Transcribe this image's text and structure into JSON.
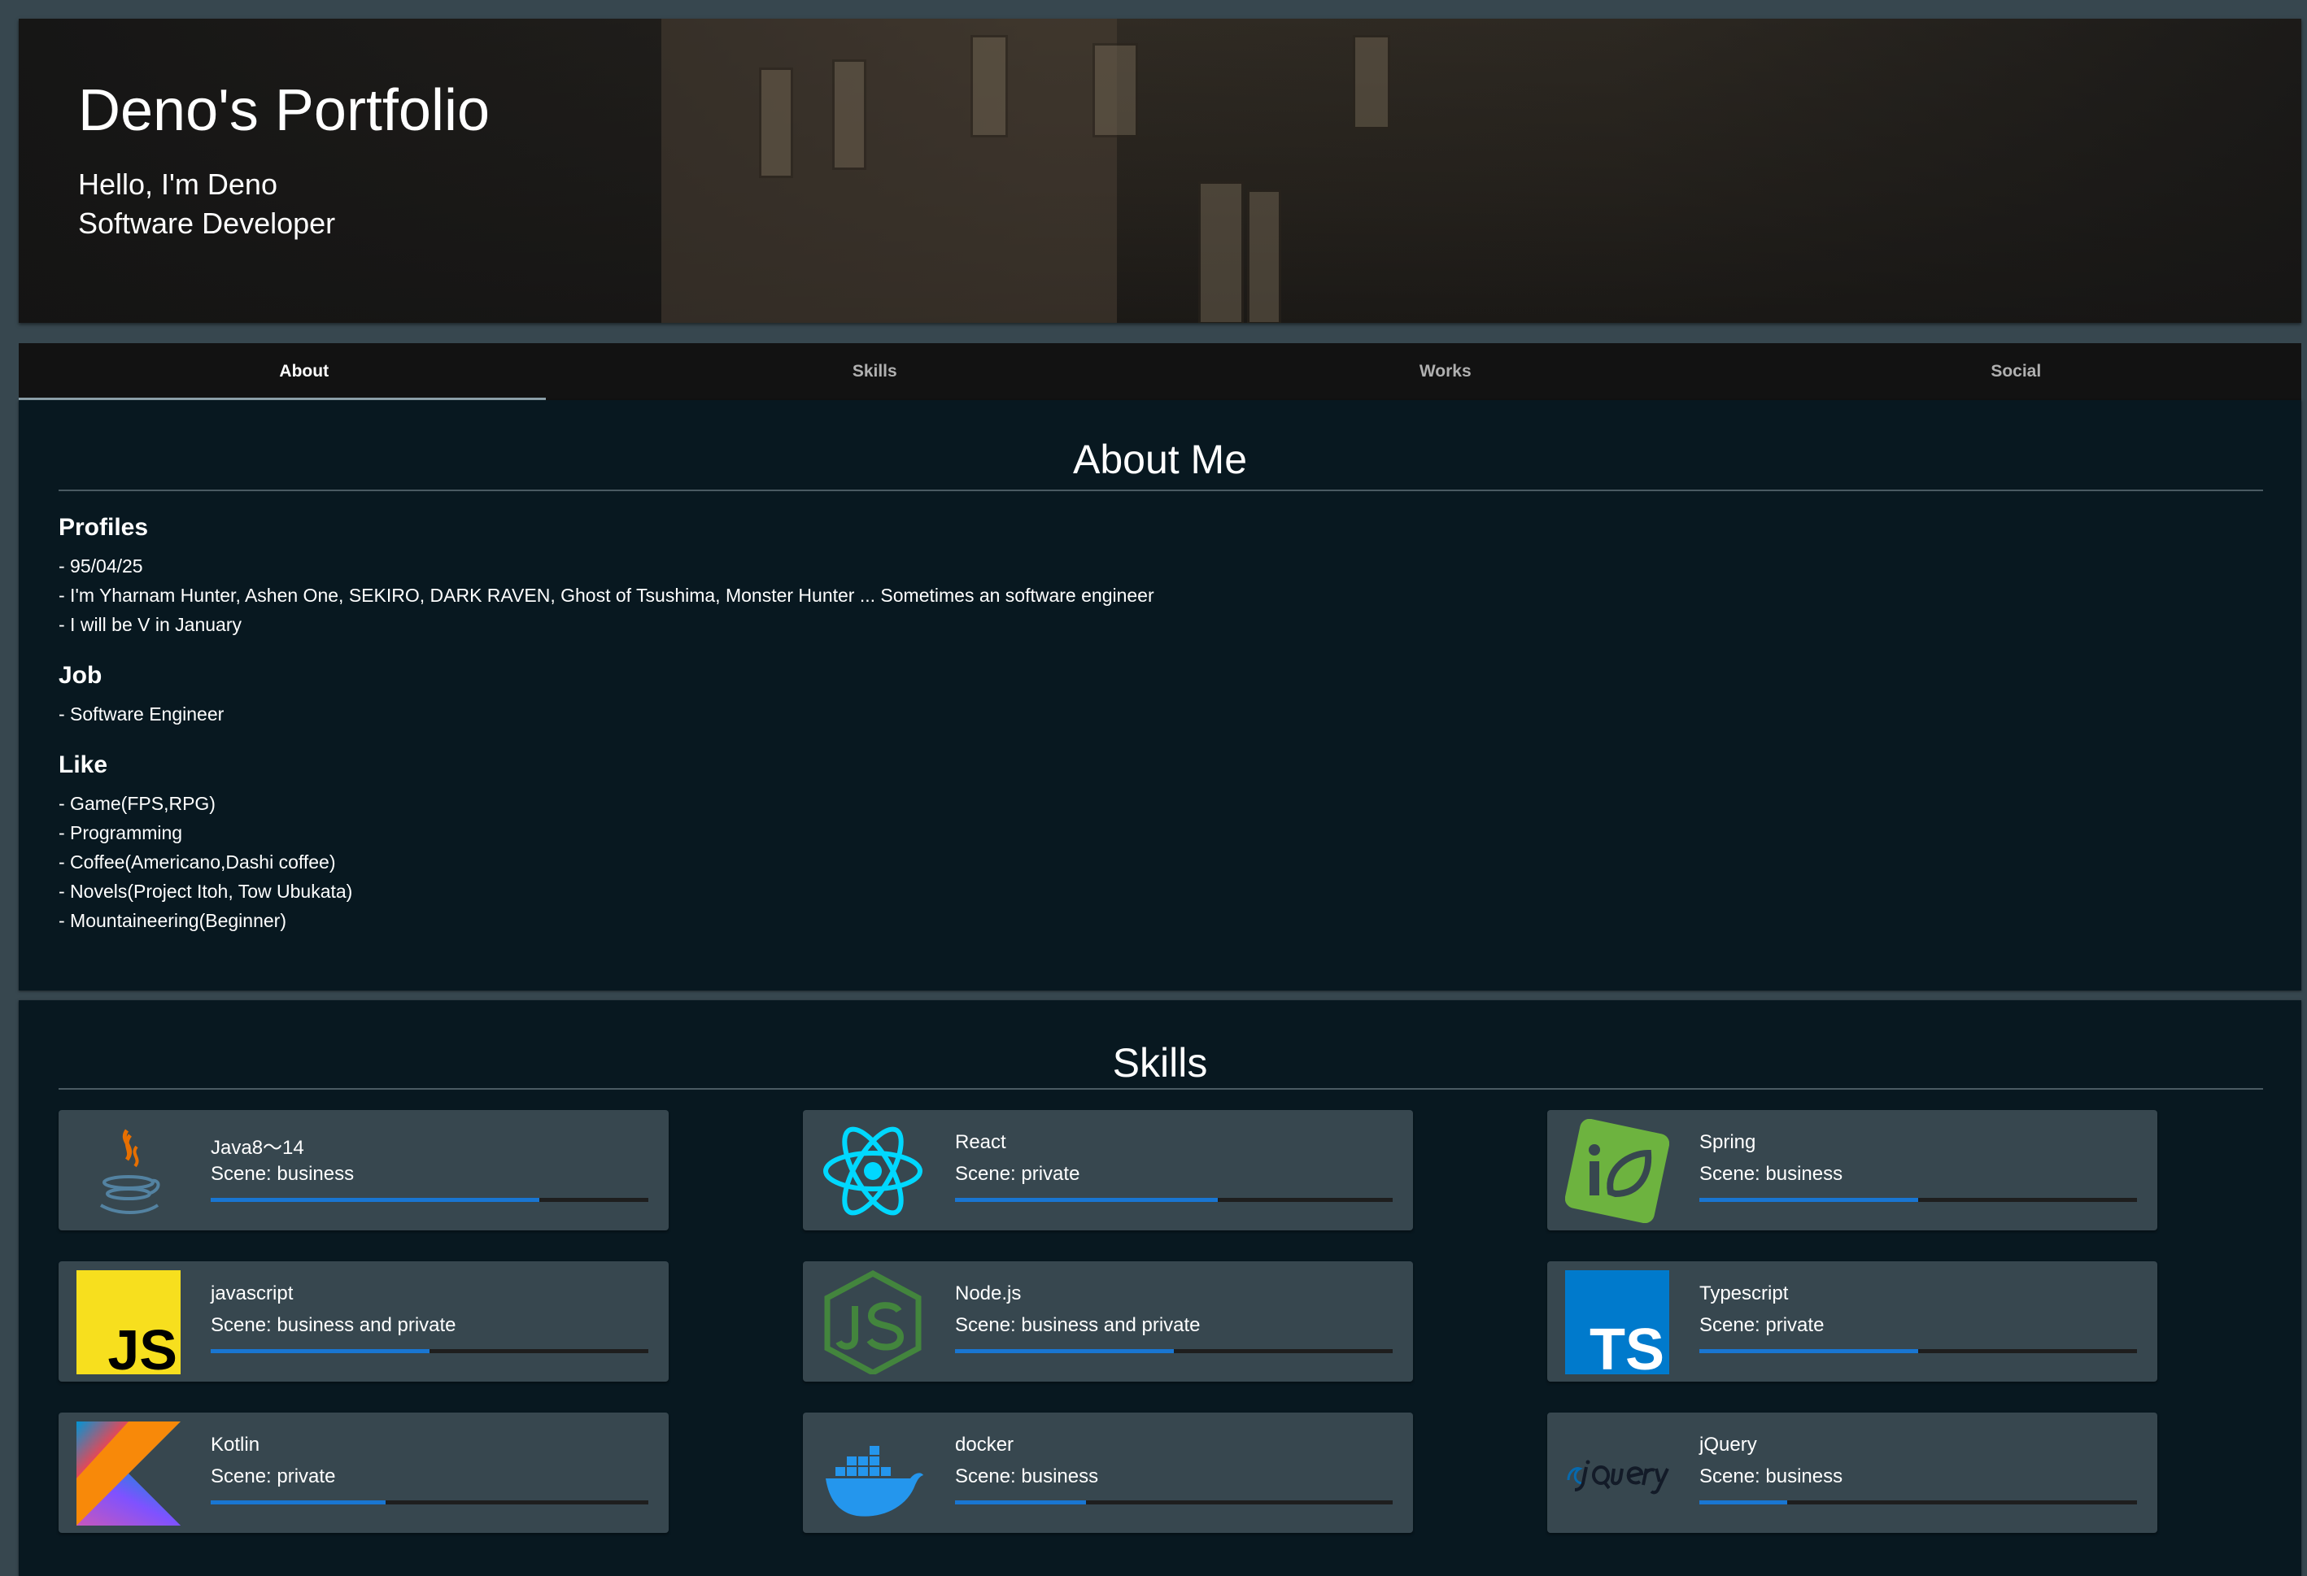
{
  "header": {
    "title": "Deno's Portfolio",
    "greeting": "Hello, I'm Deno",
    "role": "Software Developer"
  },
  "tabs": [
    {
      "label": "About",
      "active": true
    },
    {
      "label": "Skills",
      "active": false
    },
    {
      "label": "Works",
      "active": false
    },
    {
      "label": "Social",
      "active": false
    }
  ],
  "about": {
    "title": "About Me",
    "profiles": {
      "heading": "Profiles",
      "items": [
        "- 95/04/25",
        "- I'm Yharnam Hunter, Ashen One, SEKIRO, DARK RAVEN, Ghost of Tsushima, Monster Hunter ... Sometimes an software engineer",
        "- I will be V in January"
      ]
    },
    "job": {
      "heading": "Job",
      "items": [
        "- Software Engineer"
      ]
    },
    "like": {
      "heading": "Like",
      "items": [
        "- Game(FPS,RPG)",
        "- Programming",
        "- Coffee(Americano,Dashi coffee)",
        "- Novels(Project Itoh, Tow Ubukata)",
        "- Mountaineering(Beginner)"
      ]
    }
  },
  "skills": {
    "title": "Skills",
    "items": [
      {
        "name": "Java8～14",
        "scene": "Scene: business",
        "level": 0.75,
        "icon": "java-icon"
      },
      {
        "name": "React",
        "scene": "Scene: private",
        "level": 0.6,
        "icon": "react-icon"
      },
      {
        "name": "Spring",
        "scene": "Scene: business",
        "level": 0.5,
        "icon": "spring-icon"
      },
      {
        "name": "javascript",
        "scene": "Scene: business and private",
        "level": 0.5,
        "icon": "javascript-icon",
        "icon_text": "JS"
      },
      {
        "name": "Node.js",
        "scene": "Scene: business and private",
        "level": 0.5,
        "icon": "nodejs-icon"
      },
      {
        "name": "Typescript",
        "scene": "Scene: private",
        "level": 0.5,
        "icon": "typescript-icon",
        "icon_text": "TS"
      },
      {
        "name": "Kotlin",
        "scene": "Scene: private",
        "level": 0.4,
        "icon": "kotlin-icon"
      },
      {
        "name": "docker",
        "scene": "Scene: business",
        "level": 0.3,
        "icon": "docker-icon"
      },
      {
        "name": "jQuery",
        "scene": "Scene: business",
        "level": 0.2,
        "icon": "jquery-icon"
      }
    ]
  },
  "colors": {
    "page_bg": "#37474f",
    "card_bg": "#081820",
    "tile_bg": "#37474f",
    "progress": "#1976d2"
  }
}
